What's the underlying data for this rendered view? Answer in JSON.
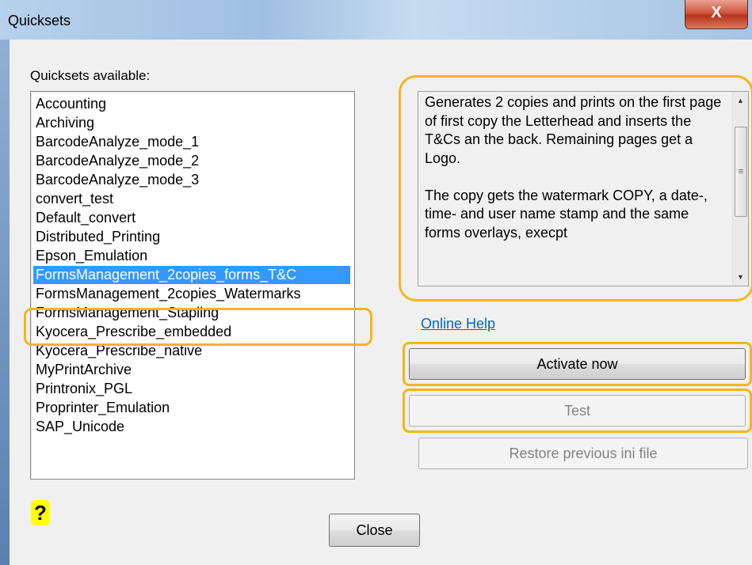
{
  "window": {
    "title": "Quicksets",
    "close_glyph": "X"
  },
  "list": {
    "label": "Quicksets available:",
    "items": [
      "Accounting",
      "Archiving",
      "BarcodeAnalyze_mode_1",
      "BarcodeAnalyze_mode_2",
      "BarcodeAnalyze_mode_3",
      "convert_test",
      "Default_convert",
      "Distributed_Printing",
      "Epson_Emulation",
      "FormsManagement_2copies_forms_T&C",
      "FormsManagement_2copies_Watermarks",
      "FormsManagement_Stapling",
      "Kyocera_Prescribe_embedded",
      "Kyocera_Prescribe_native",
      "MyPrintArchive",
      "Printronix_PGL",
      "Proprinter_Emulation",
      "SAP_Unicode"
    ],
    "selected_index": 9
  },
  "description": {
    "text": "Generates 2 copies and prints on the first page of first copy the Letterhead and inserts the T&Cs an the back. Remaining pages get a Logo.\n\nThe copy gets the watermark COPY, a date-, time- and user name stamp and the same forms overlays, execpt"
  },
  "links": {
    "online_help": "Online Help"
  },
  "buttons": {
    "activate": "Activate now",
    "test": "Test",
    "restore": "Restore previous ini file",
    "close": "Close"
  },
  "help_icon": "?",
  "colors": {
    "highlight_outline": "#f5b51a",
    "selection": "#3399ff",
    "link": "#0066cc"
  }
}
